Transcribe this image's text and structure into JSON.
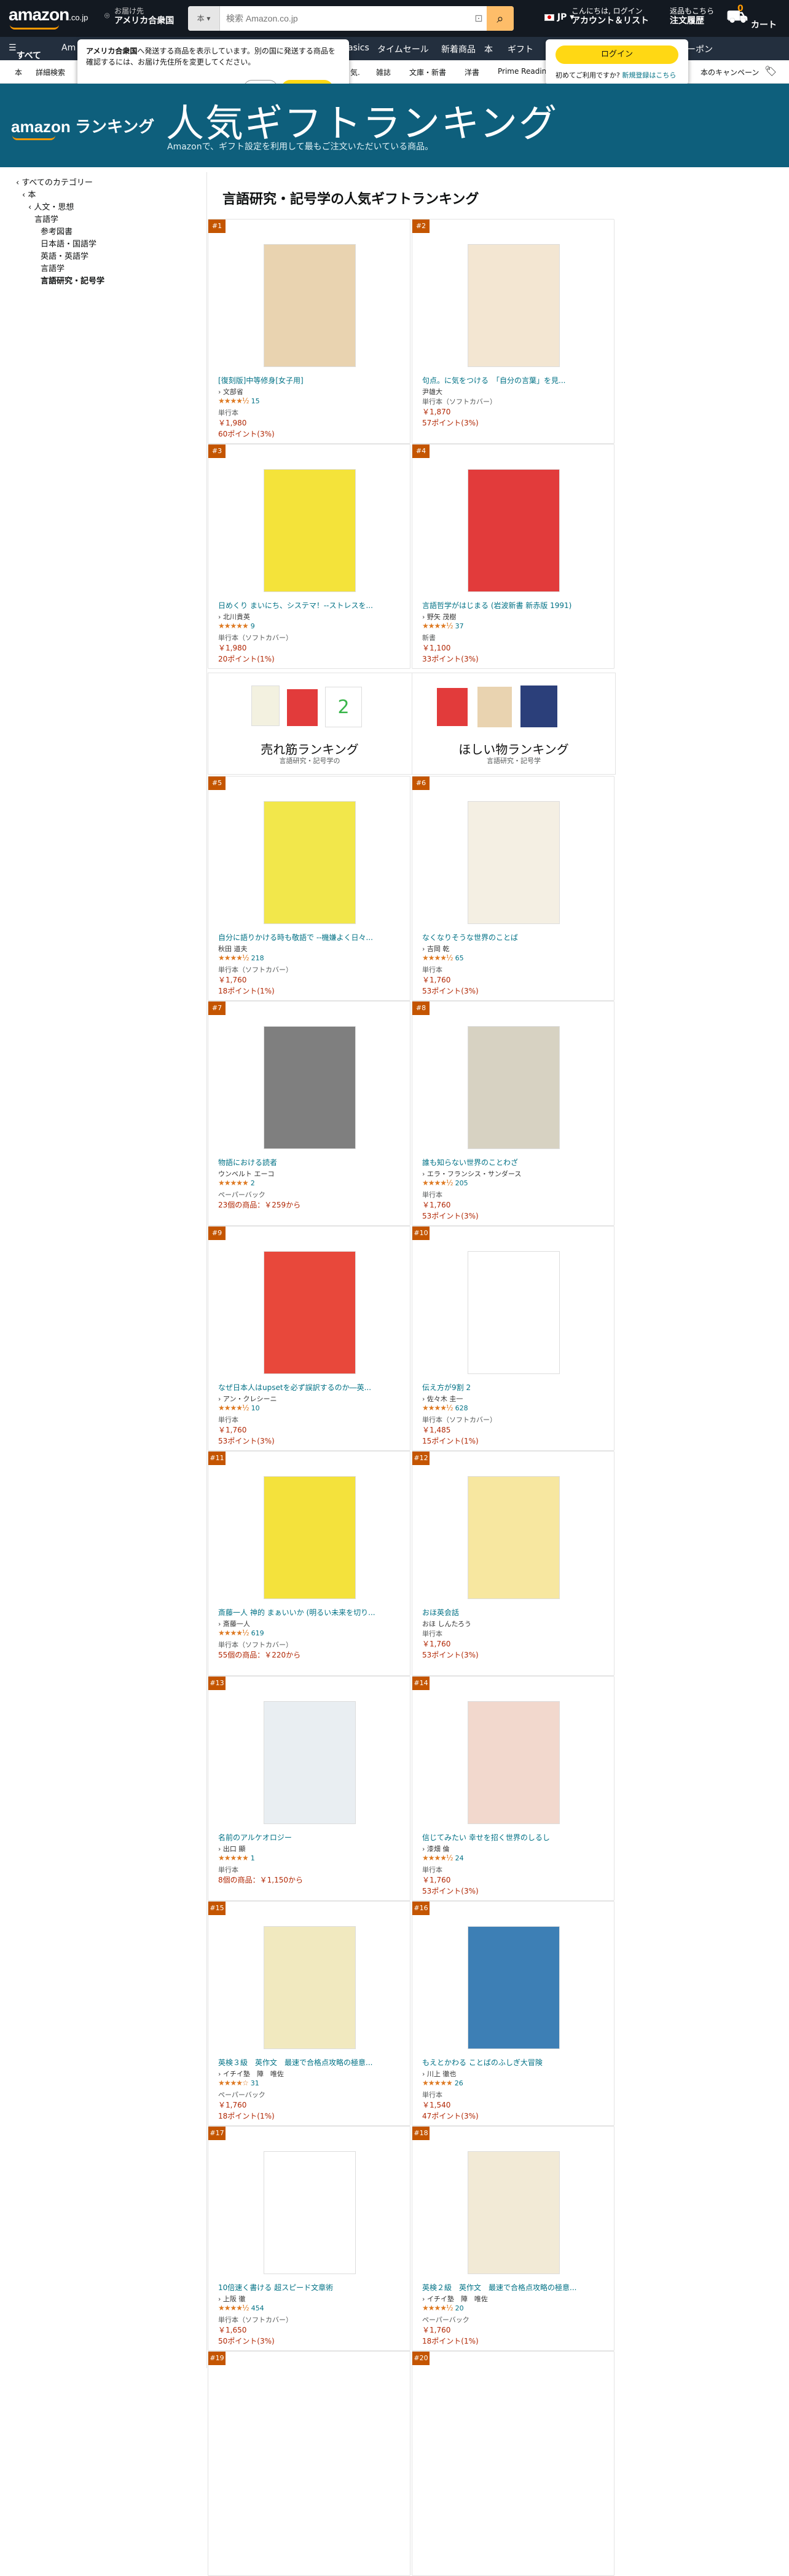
{
  "header": {
    "logo": "amazon",
    "logo_suffix": ".co.jp",
    "deliver_label": "お届け先",
    "deliver_location": "アメリカ合衆国",
    "search_category": "本",
    "search_placeholder": "検索 Amazon.co.jp",
    "lang": "JP",
    "account_line1": "こんにちは, ログイン",
    "account_line2": "アカウント＆リスト",
    "orders_line1": "返品もこちら",
    "orders_line2": "注文履歴",
    "cart_label": "カート",
    "cart_count": "0"
  },
  "navbar": {
    "all": "すべて",
    "items": [
      "Am",
      "asics",
      "タイムセール",
      "新着商品",
      "本",
      "ギフト"
    ],
    "coupon": "ーポン"
  },
  "subnav": {
    "items": [
      "本",
      "詳細検索",
      "気.",
      "雑誌",
      "文庫・新書",
      "洋書",
      "Prime Readin"
    ],
    "right": "本のキャンペーン"
  },
  "popover": {
    "bold": "アメリカ合衆国",
    "text": "へ発送する商品を表示しています。別の国に発送する商品を確認するには、お届け先住所を変更してください。",
    "continue": "続行",
    "change": "住所を変更"
  },
  "login_popover": {
    "button": "ログイン",
    "note": "初めてご利用ですか?",
    "link": "新規登録はこちら"
  },
  "banner": {
    "logo": "amazon ランキング",
    "title": "人気ギフトランキング",
    "subtitle": "Amazonで、ギフト設定を利用して最もご注文いただいている商品。"
  },
  "sidebar": {
    "items": [
      {
        "label": "‹ すべてのカテゴリー",
        "indent": 0,
        "bold": false
      },
      {
        "label": "‹ 本",
        "indent": 1,
        "bold": false
      },
      {
        "label": "‹ 人文・思想",
        "indent": 2,
        "bold": false
      },
      {
        "label": "言語学",
        "indent": 3,
        "bold": false
      },
      {
        "label": "参考図書",
        "indent": 4,
        "bold": false
      },
      {
        "label": "日本語・国語学",
        "indent": 4,
        "bold": false
      },
      {
        "label": "英語・英語学",
        "indent": 4,
        "bold": false
      },
      {
        "label": "言語学",
        "indent": 4,
        "bold": false
      },
      {
        "label": "言語研究・記号学",
        "indent": 4,
        "bold": true
      }
    ]
  },
  "page_title": "言語研究・記号学の人気ギフトランキング",
  "rank_tiles": {
    "left": {
      "label": "売れ筋ランキング",
      "sub": "言語研究・記号学の"
    },
    "right": {
      "label": "ほしい物ランキング",
      "sub": "言語研究・記号学"
    }
  },
  "products": [
    {
      "rank": "#1",
      "title": "[復刻版]中等修身[女子用]",
      "author": "› 文部省",
      "rating": 4.5,
      "stars": "★★★★½",
      "reviews": "15",
      "format": "単行本",
      "price": "￥1,980",
      "points": "60ポイント(3%)",
      "cover": "#e9d3b0"
    },
    {
      "rank": "#2",
      "title": "句点。に気をつける　「自分の言葉」を見...",
      "author": "尹雄大",
      "rating": 0,
      "stars": "",
      "reviews": "",
      "format": "単行本（ソフトカバー）",
      "price": "￥1,870",
      "points": "57ポイント(3%)",
      "cover": "#f3e6d2"
    },
    {
      "rank": "#3",
      "title": "日めくり まいにち、システマ！--ストレスを...",
      "author": "› 北川貴英",
      "rating": 5,
      "stars": "★★★★★",
      "reviews": "9",
      "format": "単行本（ソフトカバー）",
      "price": "￥1,980",
      "points": "20ポイント(1%)",
      "cover": "#f4e33a"
    },
    {
      "rank": "#4",
      "title": "言語哲学がはじまる (岩波新書 新赤版 1991)",
      "author": "› 野矢 茂樹",
      "rating": 4.5,
      "stars": "★★★★½",
      "reviews": "37",
      "format": "新書",
      "price": "￥1,100",
      "points": "33ポイント(3%)",
      "cover": "#e23b3b"
    },
    {
      "rank": "#5",
      "title": "自分に語りかける時も敬語で --機嫌よく日々...",
      "author": "秋田 道夫",
      "rating": 4.5,
      "stars": "★★★★½",
      "reviews": "218",
      "format": "単行本（ソフトカバー）",
      "price": "￥1,760",
      "points": "18ポイント(1%)",
      "cover": "#f2e74b"
    },
    {
      "rank": "#6",
      "title": "なくなりそうな世界のことば",
      "author": "› 吉岡 乾",
      "rating": 4.5,
      "stars": "★★★★½",
      "reviews": "65",
      "format": "単行本",
      "price": "￥1,760",
      "points": "53ポイント(3%)",
      "cover": "#f4efe3"
    },
    {
      "rank": "#7",
      "title": "物語における読者",
      "author": "ウンベルト エーコ",
      "rating": 5,
      "stars": "★★★★★",
      "reviews": "2",
      "format": "ペーパーバック",
      "price": "23個の商品：￥259から",
      "points": "",
      "cover": "#7f7f7f"
    },
    {
      "rank": "#8",
      "title": "誰も知らない世界のことわざ",
      "author": "› エラ・フランシス・サンダース",
      "rating": 4.5,
      "stars": "★★★★½",
      "reviews": "205",
      "format": "単行本",
      "price": "￥1,760",
      "points": "53ポイント(3%)",
      "cover": "#d7d2c2"
    },
    {
      "rank": "#9",
      "title": "なぜ日本人はupsetを必ず誤訳するのか―英...",
      "author": "› アン・クレシーニ",
      "rating": 4.5,
      "stars": "★★★★½",
      "reviews": "10",
      "format": "単行本",
      "price": "￥1,760",
      "points": "53ポイント(3%)",
      "cover": "#e8483b"
    },
    {
      "rank": "#10",
      "title": "伝え方が9割 2",
      "author": "› 佐々木 圭一",
      "rating": 4.5,
      "stars": "★★★★½",
      "reviews": "628",
      "format": "単行本（ソフトカバー）",
      "price": "￥1,485",
      "points": "15ポイント(1%)",
      "cover": "#ffffff"
    },
    {
      "rank": "#11",
      "title": "斎藤一人 神的 まぁいいか (明るい未来を切り...",
      "author": "› 斎藤一人",
      "rating": 4.5,
      "stars": "★★★★½",
      "reviews": "619",
      "format": "単行本（ソフトカバー）",
      "price": "55個の商品：￥220から",
      "points": "",
      "cover": "#f4e23c"
    },
    {
      "rank": "#12",
      "title": "おほ英会話",
      "author": "おほ しんたろう",
      "rating": 0,
      "stars": "",
      "reviews": "",
      "format": "単行本",
      "price": "￥1,760",
      "points": "53ポイント(3%)",
      "cover": "#f7e7a0"
    },
    {
      "rank": "#13",
      "title": "名前のアルケオロジー",
      "author": "› 出口 顯",
      "rating": 5,
      "stars": "★★★★★",
      "reviews": "1",
      "format": "単行本",
      "price": "8個の商品：￥1,150から",
      "points": "",
      "cover": "#e9eef2"
    },
    {
      "rank": "#14",
      "title": "信じてみたい 幸せを招く世界のしるし",
      "author": "› 漆畑 倫",
      "rating": 4.5,
      "stars": "★★★★½",
      "reviews": "24",
      "format": "単行本",
      "price": "￥1,760",
      "points": "53ポイント(3%)",
      "cover": "#f2d8cd"
    },
    {
      "rank": "#15",
      "title": "英検３級　英作文　最速で合格点攻略の極意...",
      "author": "› イチイ塾　陣　唯佐",
      "rating": 4,
      "stars": "★★★★☆",
      "reviews": "31",
      "format": "ペーパーバック",
      "price": "￥1,760",
      "points": "18ポイント(1%)",
      "cover": "#f1e9bf"
    },
    {
      "rank": "#16",
      "title": "もえとかわる ことばのふしぎ大冒険",
      "author": "› 川上 徹也",
      "rating": 5,
      "stars": "★★★★★",
      "reviews": "26",
      "format": "単行本",
      "price": "￥1,540",
      "points": "47ポイント(3%)",
      "cover": "#3d7fb5"
    },
    {
      "rank": "#17",
      "title": "10倍速く書ける 超スピード文章術",
      "author": "› 上阪 徹",
      "rating": 4.5,
      "stars": "★★★★½",
      "reviews": "454",
      "format": "単行本（ソフトカバー）",
      "price": "￥1,650",
      "points": "50ポイント(3%)",
      "cover": "#ffffff"
    },
    {
      "rank": "#18",
      "title": "英検２級　英作文　最速で合格点攻略の極意...",
      "author": "› イチイ塾　陣　唯佐",
      "rating": 4.5,
      "stars": "★★★★½",
      "reviews": "20",
      "format": "ペーパーバック",
      "price": "￥1,760",
      "points": "18ポイント(1%)",
      "cover": "#f2ead6"
    },
    {
      "rank": "#19",
      "title": "",
      "author": "",
      "rating": 0,
      "stars": "",
      "reviews": "",
      "format": "",
      "price": "",
      "points": "",
      "cover": "#ffffff"
    },
    {
      "rank": "#20",
      "title": "",
      "author": "",
      "rating": 0,
      "stars": "",
      "reviews": "",
      "format": "",
      "price": "",
      "points": "",
      "cover": "#ffffff"
    }
  ]
}
